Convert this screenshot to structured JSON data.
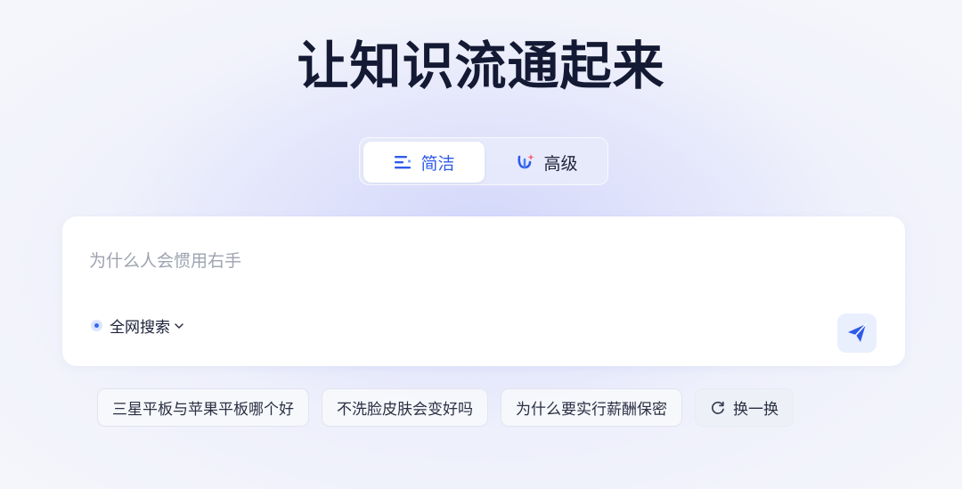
{
  "title": "让知识流通起来",
  "mode_switch": {
    "simple": {
      "label": "简洁",
      "icon": "list-icon"
    },
    "advanced": {
      "label": "高级",
      "icon": "sparkle-search-icon"
    },
    "active": "simple"
  },
  "search": {
    "placeholder": "为什么人会惯用右手",
    "value": "",
    "scope_label": "全网搜索",
    "scope_icon": "globe-dot-icon",
    "send_icon": "paper-plane-icon"
  },
  "suggestions": [
    {
      "label": "三星平板与苹果平板哪个好"
    },
    {
      "label": "不洗脸皮肤会变好吗"
    },
    {
      "label": "为什么要实行薪酬保密"
    }
  ],
  "refresh": {
    "label": "换一换",
    "icon": "refresh-icon"
  },
  "colors": {
    "accent": "#2f5bea",
    "title": "#141a33",
    "placeholder": "#9ea3b0"
  }
}
